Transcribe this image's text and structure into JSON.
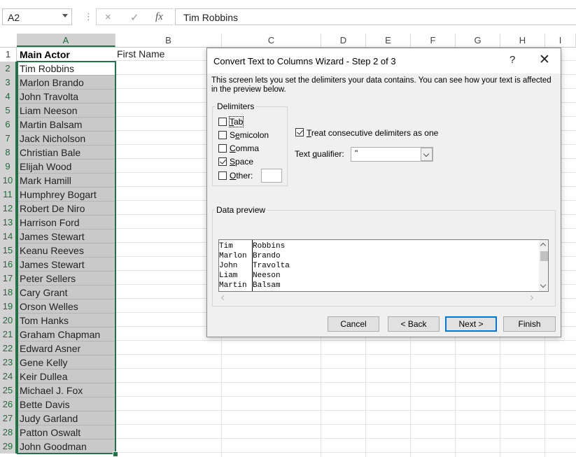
{
  "formula_bar": {
    "name_box": "A2",
    "separator": "⋮",
    "cancel_icon": "×",
    "enter_icon": "✓",
    "fx_icon": "fx",
    "formula": "Tim Robbins"
  },
  "sheet": {
    "columns": [
      "A",
      "B",
      "C",
      "D",
      "E",
      "F",
      "G",
      "H",
      "I"
    ],
    "rows": [
      "1",
      "2",
      "3",
      "4",
      "5",
      "6",
      "7",
      "8",
      "9",
      "10",
      "11",
      "12",
      "13",
      "14",
      "15",
      "16",
      "17",
      "18",
      "19",
      "20",
      "21",
      "22",
      "23",
      "24",
      "25",
      "26",
      "27",
      "28",
      "29"
    ],
    "colA": [
      "Main Actor",
      "Tim Robbins",
      "Marlon Brando",
      "John Travolta",
      "Liam Neeson",
      "Martin Balsam",
      "Jack Nicholson",
      "Christian Bale",
      "Elijah Wood",
      "Mark Hamill",
      "Humphrey Bogart",
      "Robert De Niro",
      "Harrison Ford",
      "James Stewart",
      "Keanu Reeves",
      "James Stewart",
      "Peter Sellers",
      "Cary Grant",
      "Orson Welles",
      "Tom Hanks",
      "Graham Chapman",
      "Edward Asner",
      "Gene Kelly",
      "Keir Dullea",
      "Michael J. Fox",
      "Bette Davis",
      "Judy Garland",
      "Patton Oswalt",
      "John Goodman"
    ],
    "b1": "First Name"
  },
  "dialog": {
    "title": "Convert Text to Columns Wizard - Step 2 of 3",
    "help": "?",
    "close": "✕",
    "description": "This screen lets you set the delimiters your data contains.  You can see how your text is affected in the preview below.",
    "delimiters_label": "Delimiters",
    "delimiters": [
      {
        "label_pre": "",
        "label_u": "T",
        "label_post": "ab",
        "checked": false
      },
      {
        "label_pre": "S",
        "label_u": "e",
        "label_post": "micolon",
        "checked": false
      },
      {
        "label_pre": "",
        "label_u": "C",
        "label_post": "omma",
        "checked": false
      },
      {
        "label_pre": "",
        "label_u": "S",
        "label_post": "pace",
        "checked": true
      },
      {
        "label_pre": "",
        "label_u": "O",
        "label_post": "ther:",
        "checked": false
      }
    ],
    "other_value": "",
    "consecutive": {
      "label_pre": "",
      "label_u": "T",
      "label_post": "reat consecutive delimiters as one",
      "checked": true
    },
    "qualifier": {
      "label_pre": "Text ",
      "label_u": "q",
      "label_post": "ualifier:",
      "value": "\""
    },
    "preview_label": "Data preview",
    "preview_rows": [
      [
        "Tim",
        "Robbins"
      ],
      [
        "Marlon",
        "Brando"
      ],
      [
        "John",
        "Travolta"
      ],
      [
        "Liam",
        "Neeson"
      ],
      [
        "Martin",
        "Balsam"
      ]
    ],
    "buttons": {
      "cancel": "Cancel",
      "back": "< Back",
      "next": "Next >",
      "finish": "Finish"
    }
  },
  "colors": {
    "excel_green": "#217346",
    "selection_gray": "#c9c9c9",
    "dialog_bg": "#f0f0f0",
    "focus_blue": "#0078d7"
  }
}
